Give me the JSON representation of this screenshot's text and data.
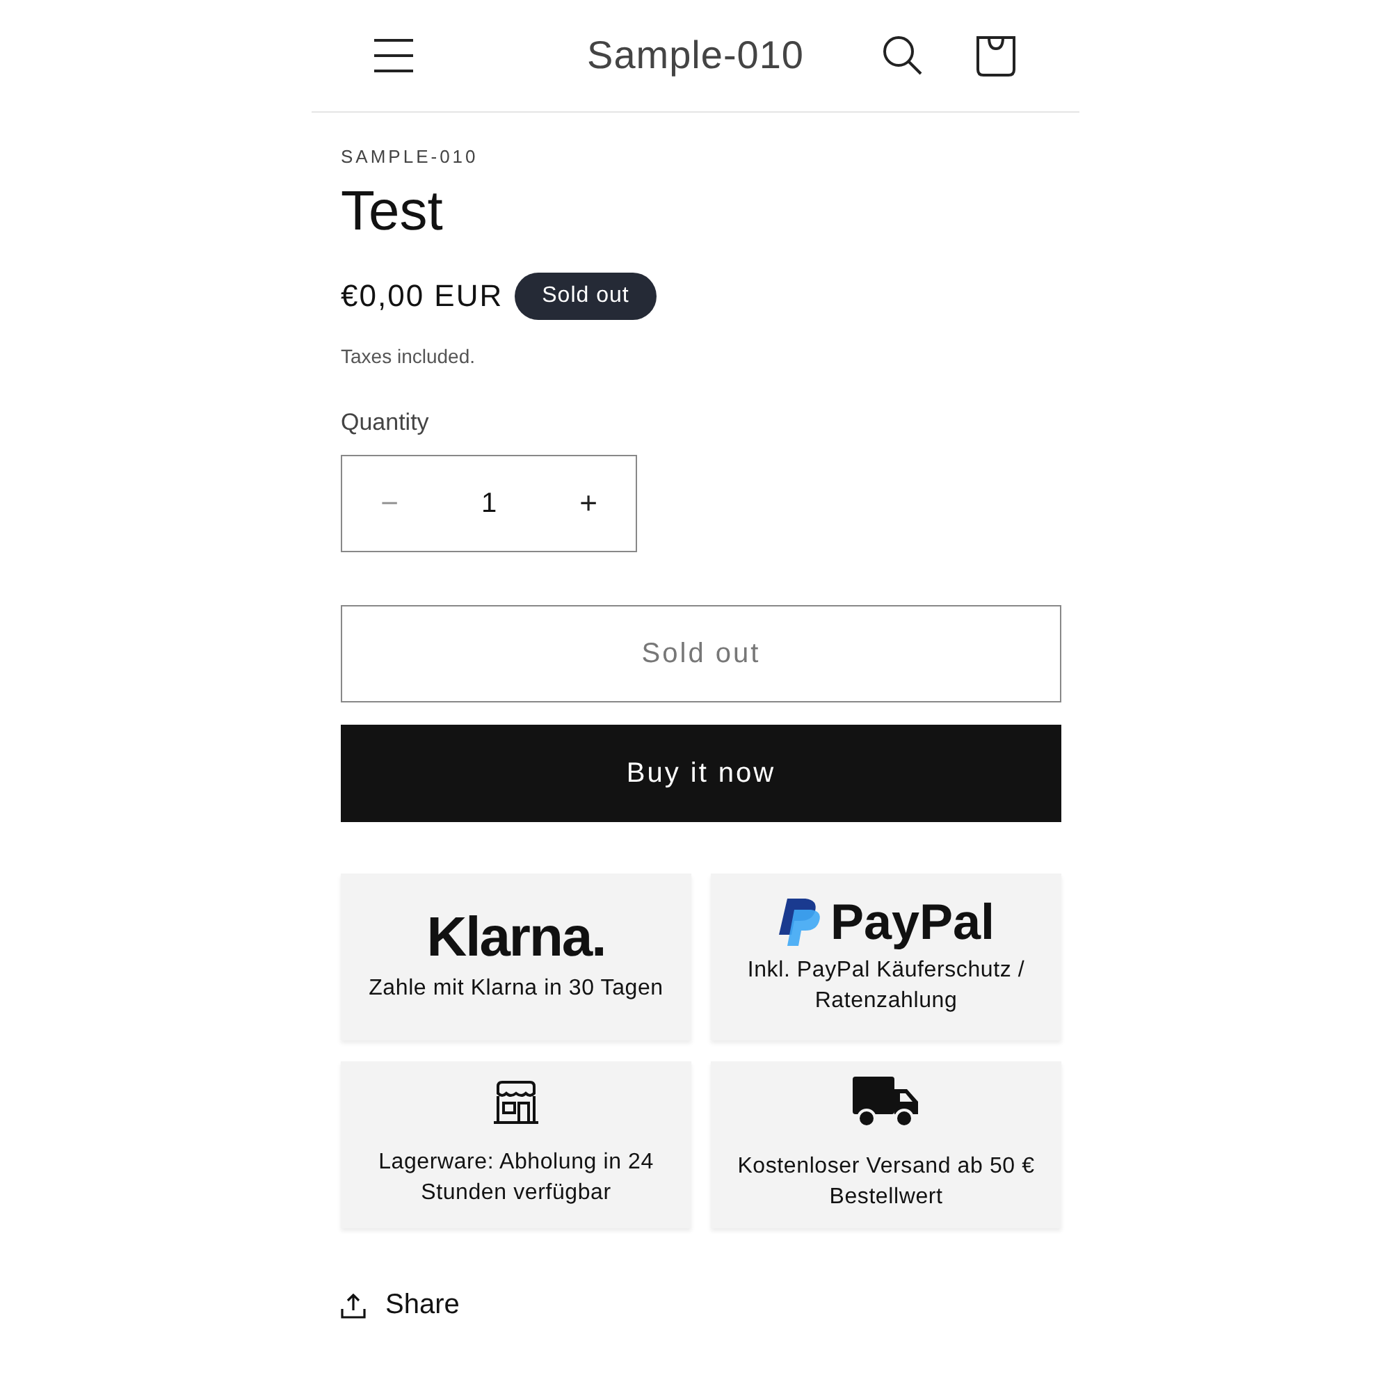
{
  "header": {
    "store_name": "Sample-010"
  },
  "product": {
    "vendor": "SAMPLE-010",
    "title": "Test",
    "price": "€0,00 EUR",
    "badge": "Sold out",
    "tax_note": "Taxes included."
  },
  "quantity": {
    "label": "Quantity",
    "minus": "−",
    "value": "1",
    "plus": "+",
    "minus_disabled": true
  },
  "buttons": [
    {
      "label": "Sold out",
      "kind": "outline",
      "disabled": true
    },
    {
      "label": "Buy it now",
      "kind": "solid",
      "disabled": false
    }
  ],
  "features": [
    {
      "kind": "klarna",
      "logo": "Klarna.",
      "text": "Zahle mit Klarna in 30 Tagen"
    },
    {
      "kind": "paypal",
      "logo": "PayPal",
      "text": "Inkl. PayPal Käuferschutz / Ratenzahlung"
    },
    {
      "kind": "store",
      "text": "Lagerware: Abholung in 24 Stunden verfügbar"
    },
    {
      "kind": "truck",
      "text": "Kostenloser Versand ab 50 € Bestellwert"
    }
  ],
  "share": {
    "label": "Share"
  }
}
